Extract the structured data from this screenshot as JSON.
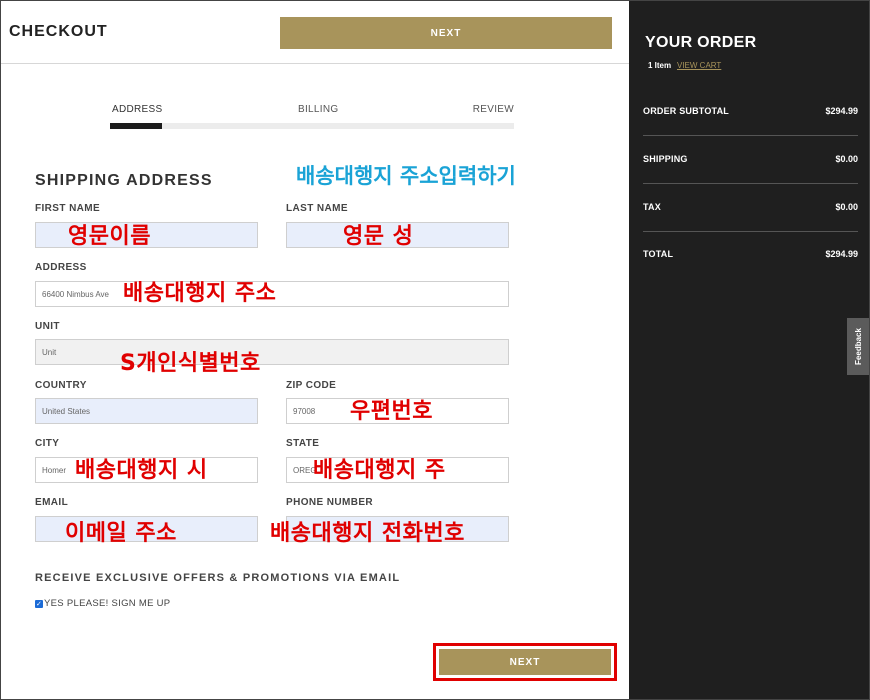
{
  "header": {
    "title": "CHECKOUT",
    "next_label": "NEXT"
  },
  "steps": [
    {
      "label": "ADDRESS",
      "active": true
    },
    {
      "label": "BILLING",
      "active": false
    },
    {
      "label": "REVIEW",
      "active": false
    }
  ],
  "form": {
    "section_title": "SHIPPING ADDRESS",
    "first_name": {
      "label": "FIRST NAME",
      "value": ""
    },
    "last_name": {
      "label": "LAST NAME",
      "value": ""
    },
    "address": {
      "label": "ADDRESS",
      "value": "66400 Nimbus Ave"
    },
    "unit": {
      "label": "UNIT",
      "placeholder": "Unit"
    },
    "country": {
      "label": "COUNTRY",
      "value": "United States"
    },
    "zip": {
      "label": "ZIP CODE",
      "value": "97008"
    },
    "city": {
      "label": "CITY",
      "value": "Homer"
    },
    "state": {
      "label": "STATE",
      "value": "OREG"
    },
    "email": {
      "label": "EMAIL",
      "value": ""
    },
    "phone": {
      "label": "PHONE NUMBER",
      "value": ""
    }
  },
  "offers": {
    "title": "RECEIVE EXCLUSIVE OFFERS & PROMOTIONS VIA EMAIL",
    "checkbox_label": "YES PLEASE! SIGN ME UP",
    "checked": true
  },
  "footer": {
    "next_label": "NEXT"
  },
  "annotations": {
    "title": "배송대행지 주소입력하기",
    "first_name": "영문이름",
    "last_name": "영문 성",
    "address": "배송대행지 주소",
    "unit": "S개인식별번호",
    "zip": "우편번호",
    "city": "배송대행지 시",
    "state": "배송대행지 주",
    "email": "이메일 주소",
    "phone": "배송대행지 전화번호"
  },
  "order": {
    "title": "YOUR ORDER",
    "item_count": "1 Item",
    "view_cart": "VIEW CART",
    "rows": [
      {
        "label": "ORDER SUBTOTAL",
        "value": "$294.99"
      },
      {
        "label": "SHIPPING",
        "value": "$0.00"
      },
      {
        "label": "TAX",
        "value": "$0.00"
      },
      {
        "label": "TOTAL",
        "value": "$294.99"
      }
    ]
  },
  "feedback_label": "Feedback",
  "colors": {
    "accent_gold": "#a8945b",
    "panel_dark": "#1f1f1f",
    "annotation_red": "#e00000",
    "annotation_blue": "#1aa3d6",
    "autofill_blue": "#e8eefb"
  }
}
